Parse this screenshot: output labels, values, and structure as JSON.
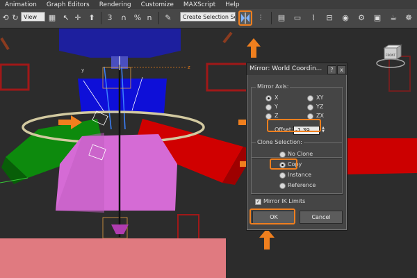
{
  "menu": [
    "Animation",
    "Graph Editors",
    "Rendering",
    "Customize",
    "MAXScript",
    "Help"
  ],
  "toolbar": {
    "view_select": "View",
    "selection_set": "Create Selection Se",
    "snap_angle": "3",
    "percent_snap": "%",
    "spinner_snap": "n"
  },
  "dialog": {
    "title": "Mirror: World Coordin...",
    "help_button": "?",
    "close_button": "x",
    "mirror_axis": {
      "label": "Mirror Axis:",
      "options": [
        "X",
        "Y",
        "Z",
        "XY",
        "YZ",
        "ZX"
      ],
      "selected": "X"
    },
    "offset": {
      "label": "Offset:",
      "value": "-1.39"
    },
    "clone_selection": {
      "label": "Clone Selection:",
      "options": [
        "No Clone",
        "Copy",
        "Instance",
        "Reference"
      ],
      "selected": "Copy"
    },
    "mirror_ik": {
      "label": "Mirror IK Limits",
      "checked": true
    },
    "ok_label": "OK",
    "cancel_label": "Cancel"
  },
  "viewcube": {
    "label": "FRONT"
  },
  "highlight_color": "#f07f1e"
}
